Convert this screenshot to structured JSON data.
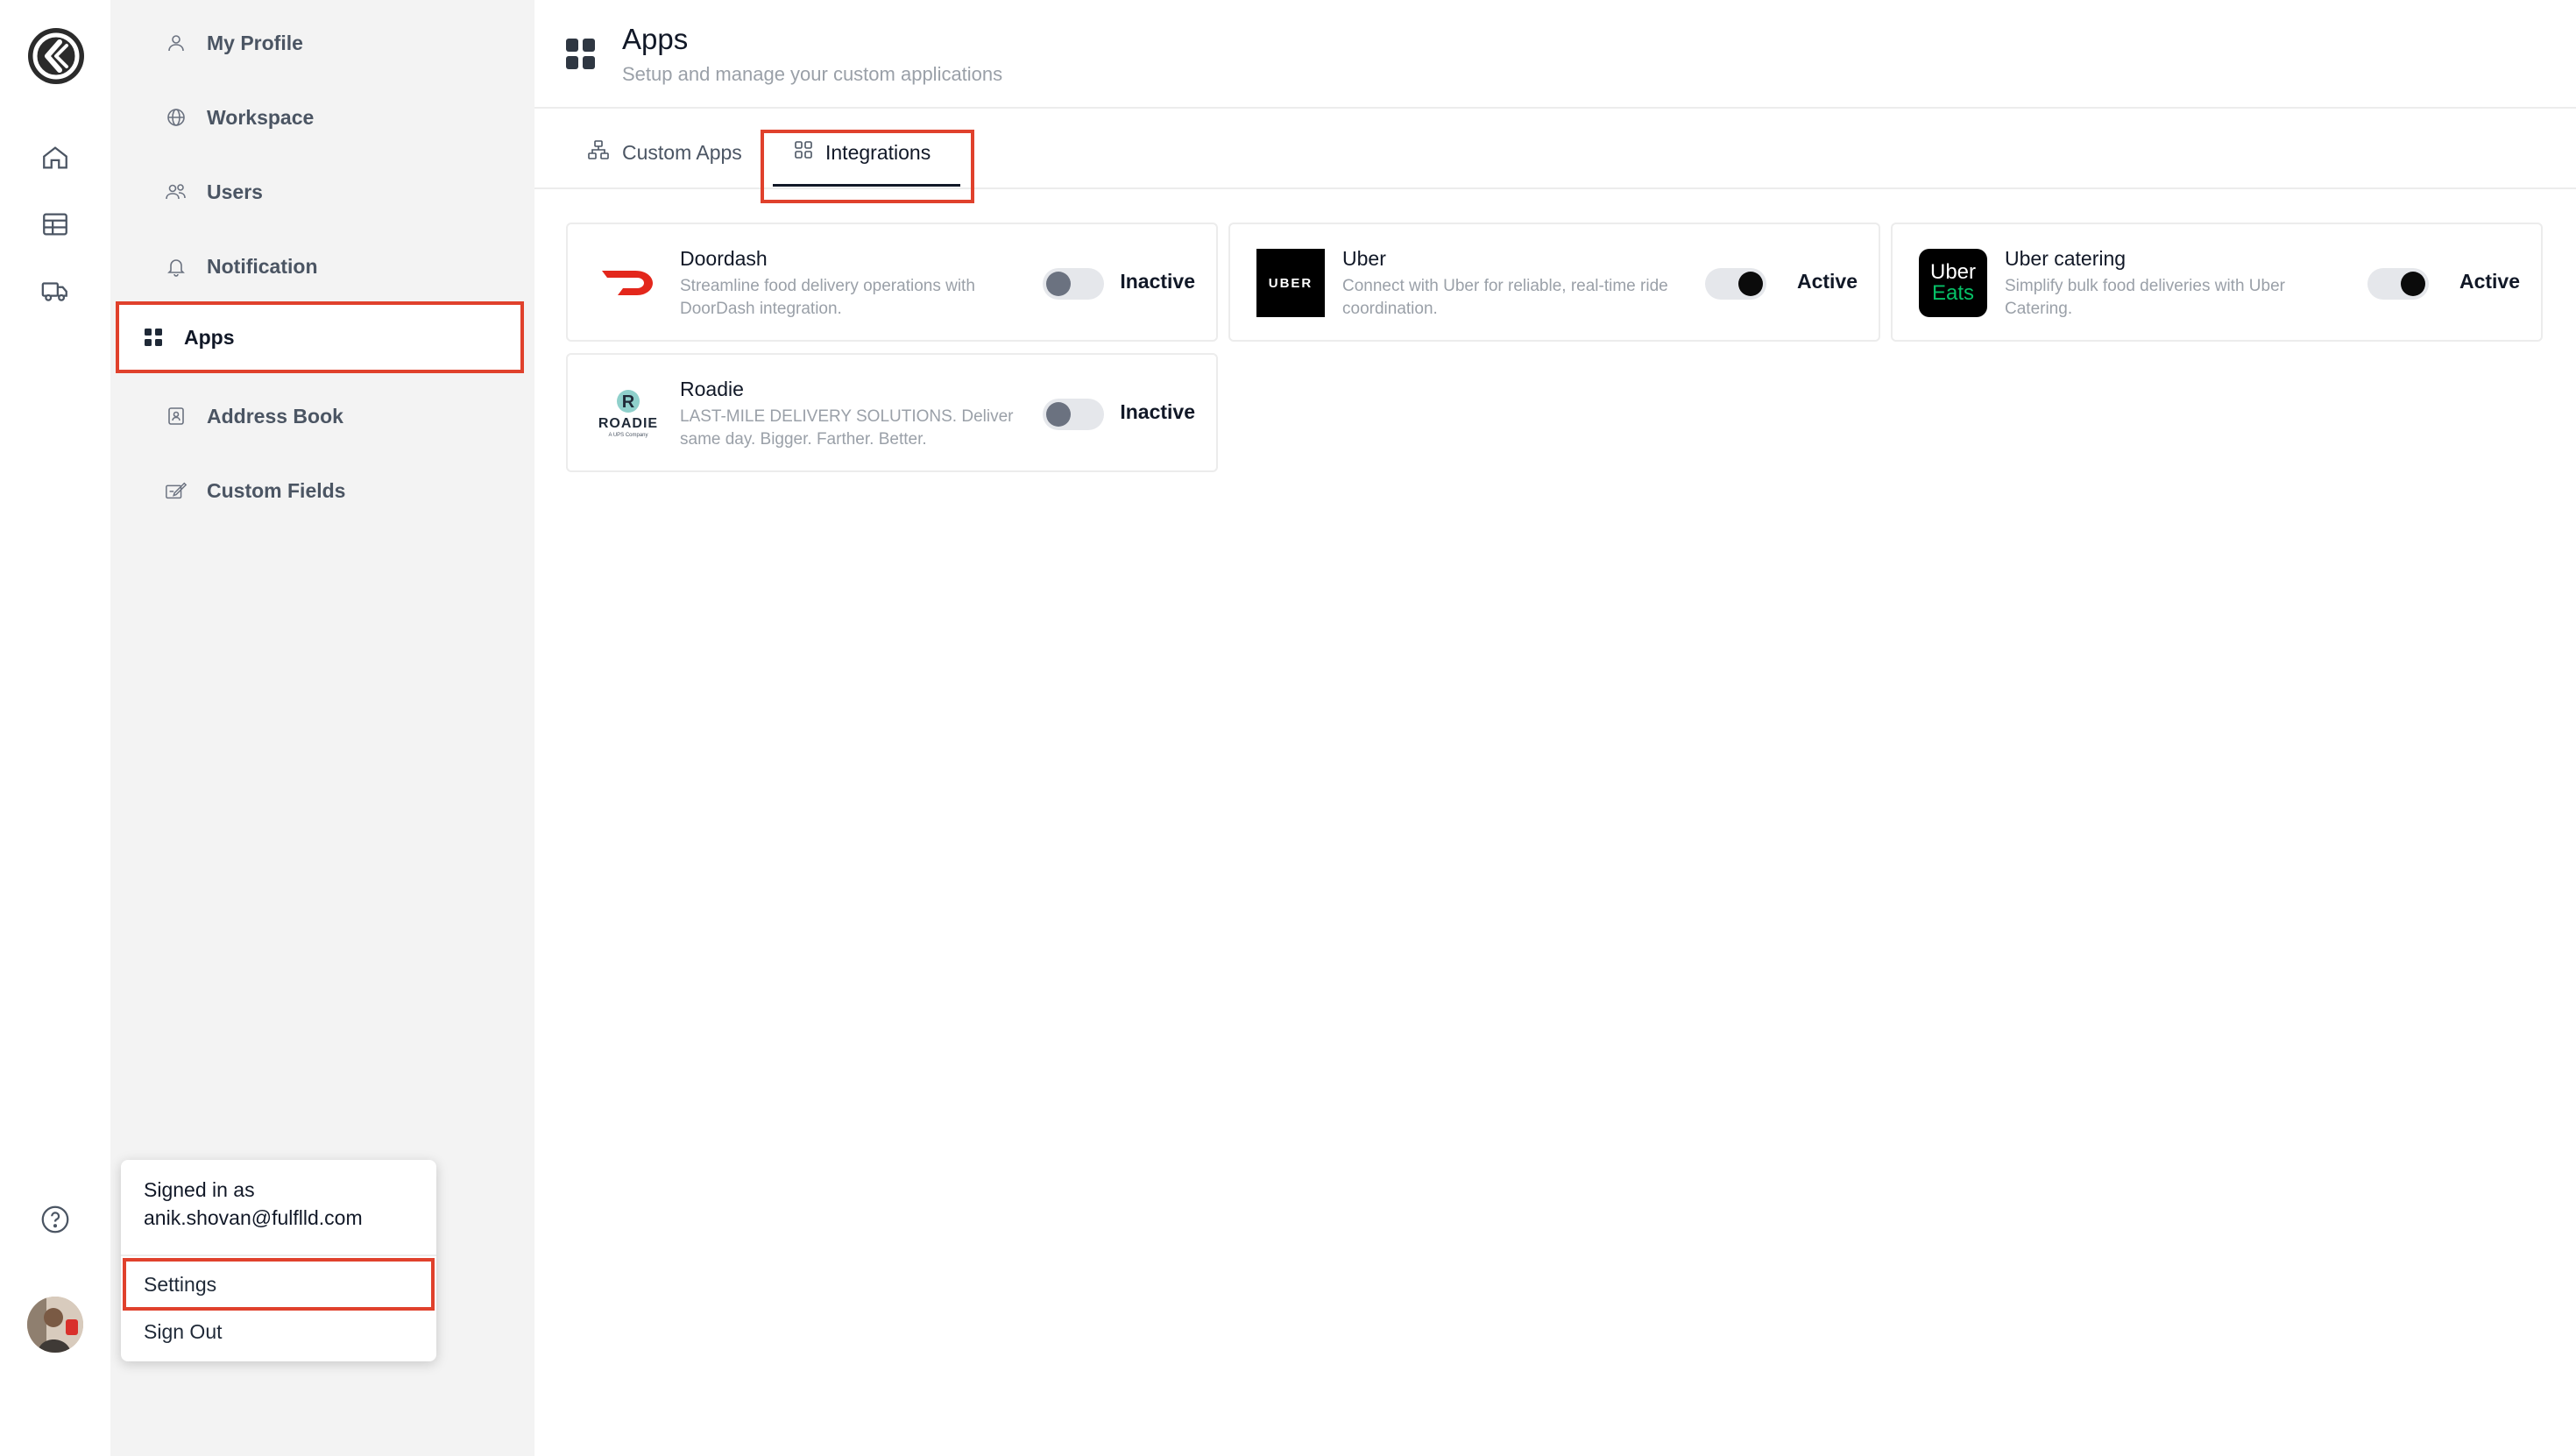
{
  "rail": {
    "icons": [
      "logo-icon",
      "home-icon",
      "table-icon",
      "truck-icon",
      "help-icon"
    ]
  },
  "sidebar": {
    "items": [
      {
        "label": "My Profile",
        "icon": "user-icon"
      },
      {
        "label": "Workspace",
        "icon": "globe-icon"
      },
      {
        "label": "Users",
        "icon": "users-icon"
      },
      {
        "label": "Notification",
        "icon": "bell-icon"
      },
      {
        "label": "Apps",
        "icon": "apps-grid-icon",
        "active": true
      },
      {
        "label": "Address Book",
        "icon": "contact-book-icon"
      },
      {
        "label": "Custom Fields",
        "icon": "edit-fields-icon"
      }
    ]
  },
  "popover": {
    "signed_in_label": "Signed in as",
    "email": "anik.shovan@fulflld.com",
    "settings_label": "Settings",
    "signout_label": "Sign Out"
  },
  "header": {
    "title": "Apps",
    "subtitle": "Setup and manage your custom applications"
  },
  "tabs": [
    {
      "label": "Custom Apps",
      "icon": "sitemap-icon"
    },
    {
      "label": "Integrations",
      "icon": "grid-icon",
      "active": true
    }
  ],
  "integrations": [
    {
      "name": "Doordash",
      "description": "Streamline food delivery operations with DoorDash integration.",
      "active": false,
      "status": "Inactive",
      "logo": "doordash-logo",
      "accent": "#e3271c"
    },
    {
      "name": "Uber",
      "description": "Connect with Uber for reliable, real-time ride coordination.",
      "active": true,
      "status": "Active",
      "logo": "uber-logo",
      "logo_text": "UBER"
    },
    {
      "name": "Uber catering",
      "description": "Simplify bulk food deliveries with Uber Catering.",
      "active": true,
      "status": "Active",
      "logo": "uber-eats-logo",
      "logo_text_1": "Uber",
      "logo_text_2": "Eats",
      "accent": "#06c167"
    },
    {
      "name": "Roadie",
      "description": "LAST-MILE DELIVERY SOLUTIONS. Deliver same day. Bigger. Farther. Better.",
      "active": false,
      "status": "Inactive",
      "logo": "roadie-logo",
      "logo_text": "ROADIE",
      "logo_sub": "A UPS Company"
    }
  ],
  "colors": {
    "highlight": "#e0412c",
    "sidebar_bg": "#f3f3f3",
    "muted_text": "#9aa0a8"
  }
}
